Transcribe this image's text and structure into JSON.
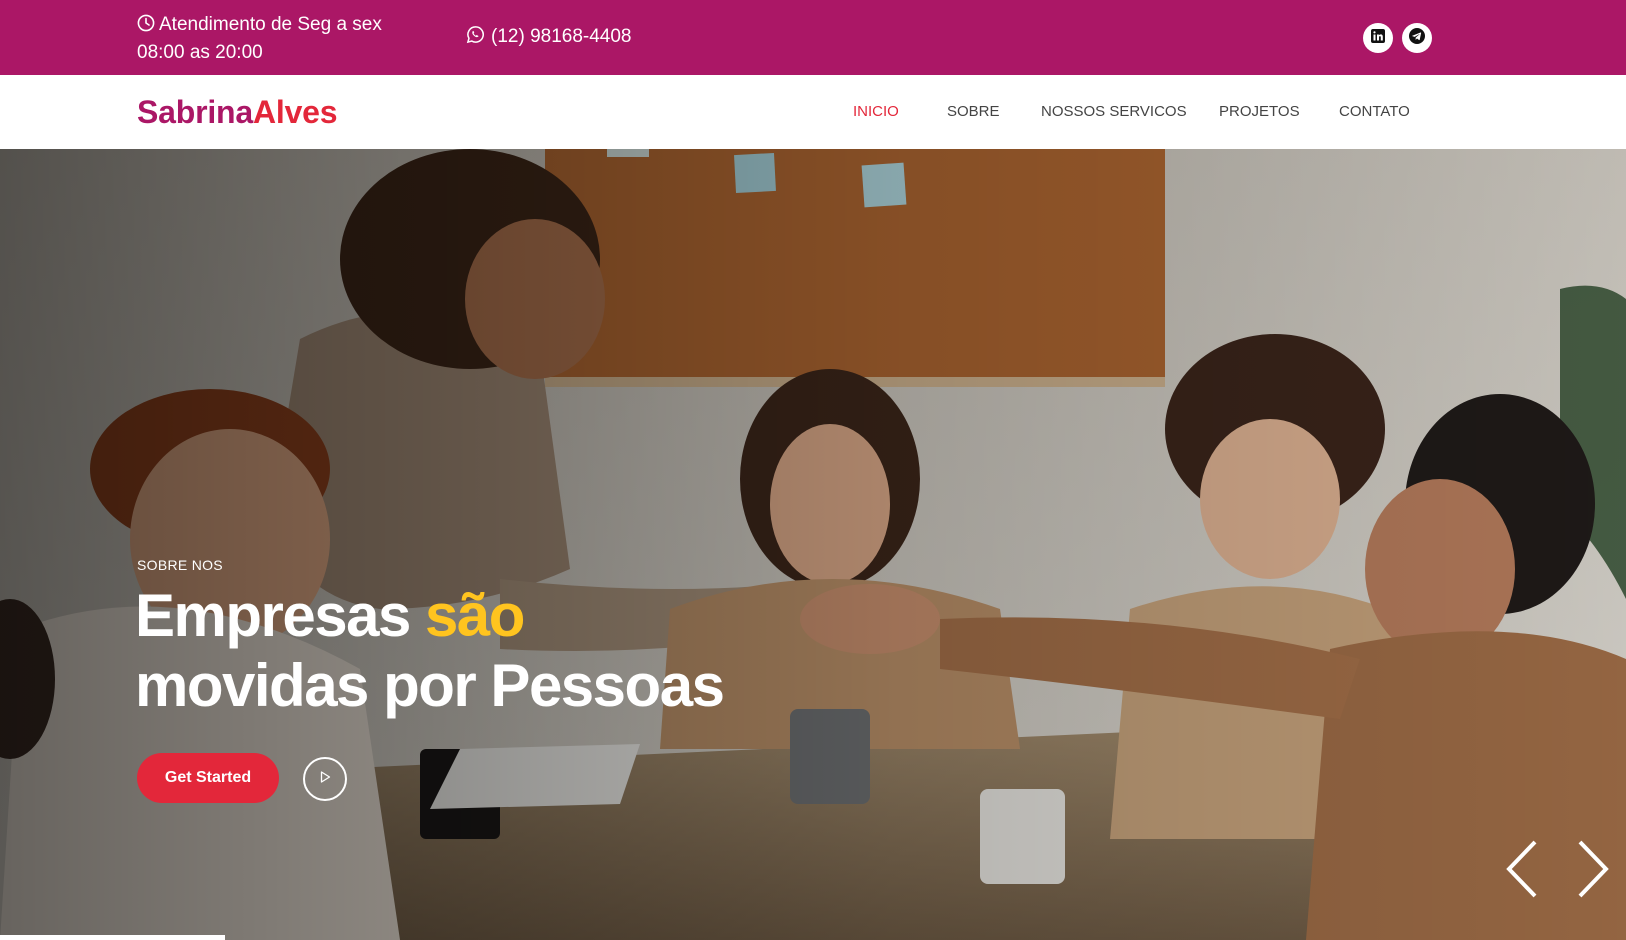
{
  "topbar": {
    "hours_line1": "Atendimento de Seg a sex",
    "hours_line2": "08:00 as 20:00",
    "phone": "(12) 98168-4408",
    "background": "#ab1766",
    "social": [
      {
        "icon": "linkedin-icon"
      },
      {
        "icon": "telegram-icon"
      }
    ]
  },
  "header": {
    "logo_part1": "Sabrina",
    "logo_part2": "Alves",
    "nav": [
      {
        "label": "INICIO",
        "active": true
      },
      {
        "label": "SOBRE"
      },
      {
        "label": "NOSSOS SERVICOS"
      },
      {
        "label": "PROJETOS"
      },
      {
        "label": "CONTATO"
      }
    ]
  },
  "hero": {
    "kicker": "SOBRE NOS",
    "headline_part1": "Empresas",
    "headline_highlight": "são",
    "headline_line2": "movidas por Pessoas",
    "cta_label": "Get Started",
    "colors": {
      "accent": "#e3273a",
      "highlight": "#ffc41f",
      "brand": "#ab1766"
    }
  }
}
